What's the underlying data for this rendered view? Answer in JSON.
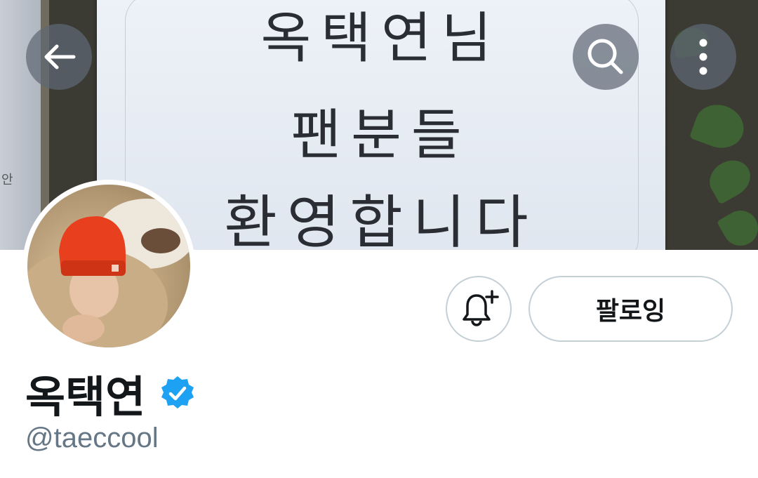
{
  "banner": {
    "sign_lines": [
      "옥택연님",
      "팬분들",
      "환영합니다"
    ],
    "left_glass_text": "안"
  },
  "toolbar": {
    "back_icon": "arrow-left-icon",
    "search_icon": "search-icon",
    "more_icon": "more-vertical-icon"
  },
  "profile": {
    "display_name": "옥택연",
    "handle": "@taeccool",
    "verified_icon": "verified-badge-icon",
    "notify_icon": "bell-plus-icon",
    "follow_label": "팔로잉"
  },
  "colors": {
    "accent": "#1da1f2",
    "handle_gray": "#657786",
    "button_border": "#c4cfd6",
    "text": "#14171a"
  }
}
